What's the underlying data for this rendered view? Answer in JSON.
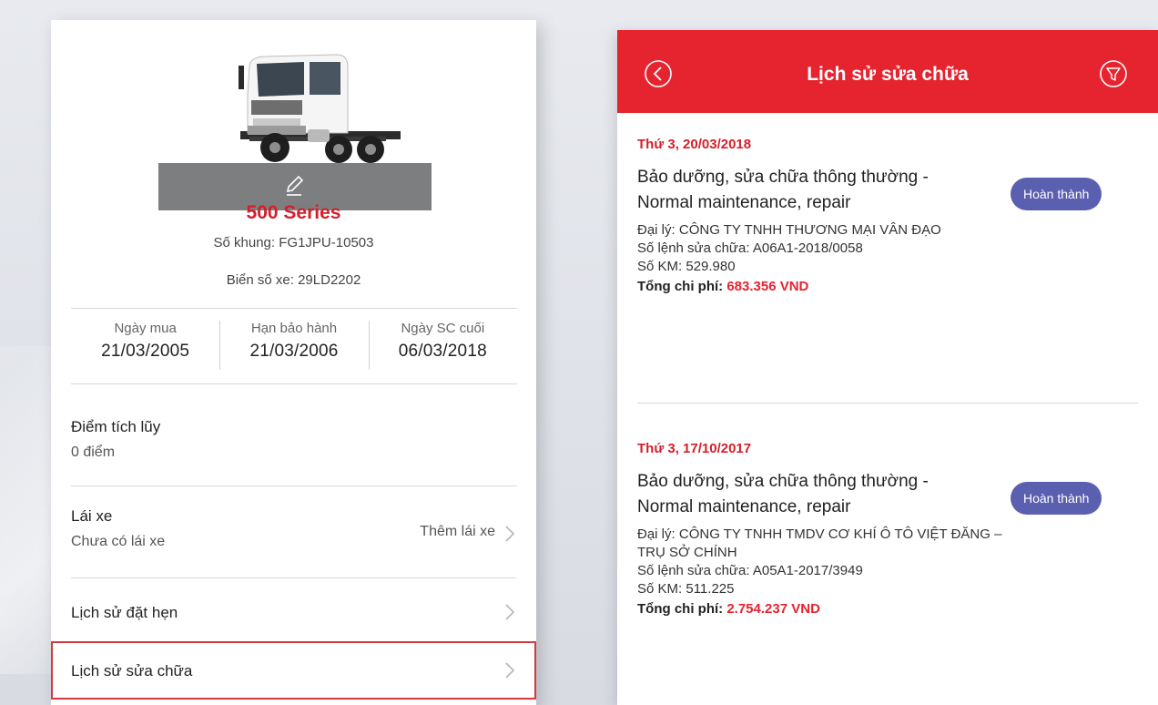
{
  "vehicle": {
    "model": "500 Series",
    "chassis_label": "Số khung:",
    "chassis_value": "FG1JPU-10503",
    "plate_label": "Biển số xe:",
    "plate_value": "29LD2202"
  },
  "stats": [
    {
      "label": "Ngày mua",
      "value": "21/03/2005"
    },
    {
      "label": "Hạn bảo hành",
      "value": "21/03/2006"
    },
    {
      "label": "Ngày SC cuối",
      "value": "06/03/2018"
    }
  ],
  "points": {
    "title": "Điểm tích lũy",
    "value": "0 điểm"
  },
  "driver": {
    "title": "Lái xe",
    "value": "Chưa có lái xe",
    "action": "Thêm lái xe"
  },
  "menu": {
    "appointments": "Lịch sử đặt hẹn",
    "repairs": "Lịch sử sửa chữa"
  },
  "screen": {
    "title": "Lịch sử sửa chữa"
  },
  "labels": {
    "dealer": "Đại lý:",
    "order": "Số lệnh sửa chữa:",
    "km": "Số KM:",
    "total": "Tổng chi phí:"
  },
  "records": [
    {
      "date": "Thứ 3, 20/03/2018",
      "title": "Bảo dưỡng, sửa chữa thông thường - Normal maintenance, repair",
      "status": "Hoàn thành",
      "dealer": "CÔNG TY TNHH THƯƠNG MẠI VÂN ĐẠO",
      "order": "A06A1-2018/0058",
      "km": "529.980",
      "total": "683.356 VND"
    },
    {
      "date": "Thứ 3, 17/10/2017",
      "title": "Bảo dưỡng, sửa chữa thông thường - Normal maintenance, repair",
      "status": "Hoàn thành",
      "dealer": "CÔNG TY TNHH TMDV CƠ KHÍ Ô TÔ VIỆT ĐĂNG – TRỤ SỞ CHÍNH",
      "order": "A05A1-2017/3949",
      "km": "511.225",
      "total": "2.754.237 VND"
    }
  ],
  "colors": {
    "brand_red": "#e6242f",
    "status_badge": "#5b5fb0",
    "photo_bar": "#7d7e80"
  },
  "icons": {
    "edit": "pencil-icon",
    "back": "chevron-left-circle-icon",
    "filter": "filter-circle-icon",
    "menu_arrow": "chevron-right-icon"
  }
}
